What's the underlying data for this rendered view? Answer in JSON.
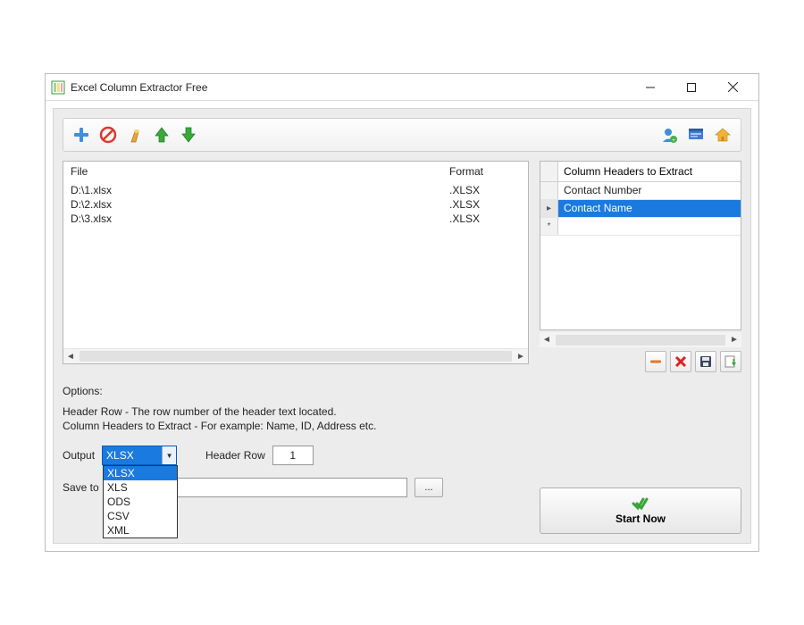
{
  "window": {
    "title": "Excel Column Extractor Free"
  },
  "fileList": {
    "columns": {
      "file": "File",
      "format": "Format"
    },
    "rows": [
      {
        "file": "D:\\1.xlsx",
        "format": ".XLSX"
      },
      {
        "file": "D:\\2.xlsx",
        "format": ".XLSX"
      },
      {
        "file": "D:\\3.xlsx",
        "format": ".XLSX"
      }
    ]
  },
  "headersGrid": {
    "title": "Column Headers to Extract",
    "rows": [
      "Contact Number",
      "Contact Name"
    ],
    "selectedIndex": 1
  },
  "options": {
    "title": "Options:",
    "help1": "Header Row - The row number of the header text located.",
    "help2": "Column Headers to Extract - For example: Name, ID, Address etc.",
    "outputLabel": "Output",
    "outputValue": "XLSX",
    "outputOptions": [
      "XLSX",
      "XLS",
      "ODS",
      "CSV",
      "XML"
    ],
    "headerRowLabel": "Header Row",
    "headerRowValue": "1",
    "saveToLabel": "Save to",
    "browseLabel": "..."
  },
  "start": {
    "label": "Start Now"
  }
}
